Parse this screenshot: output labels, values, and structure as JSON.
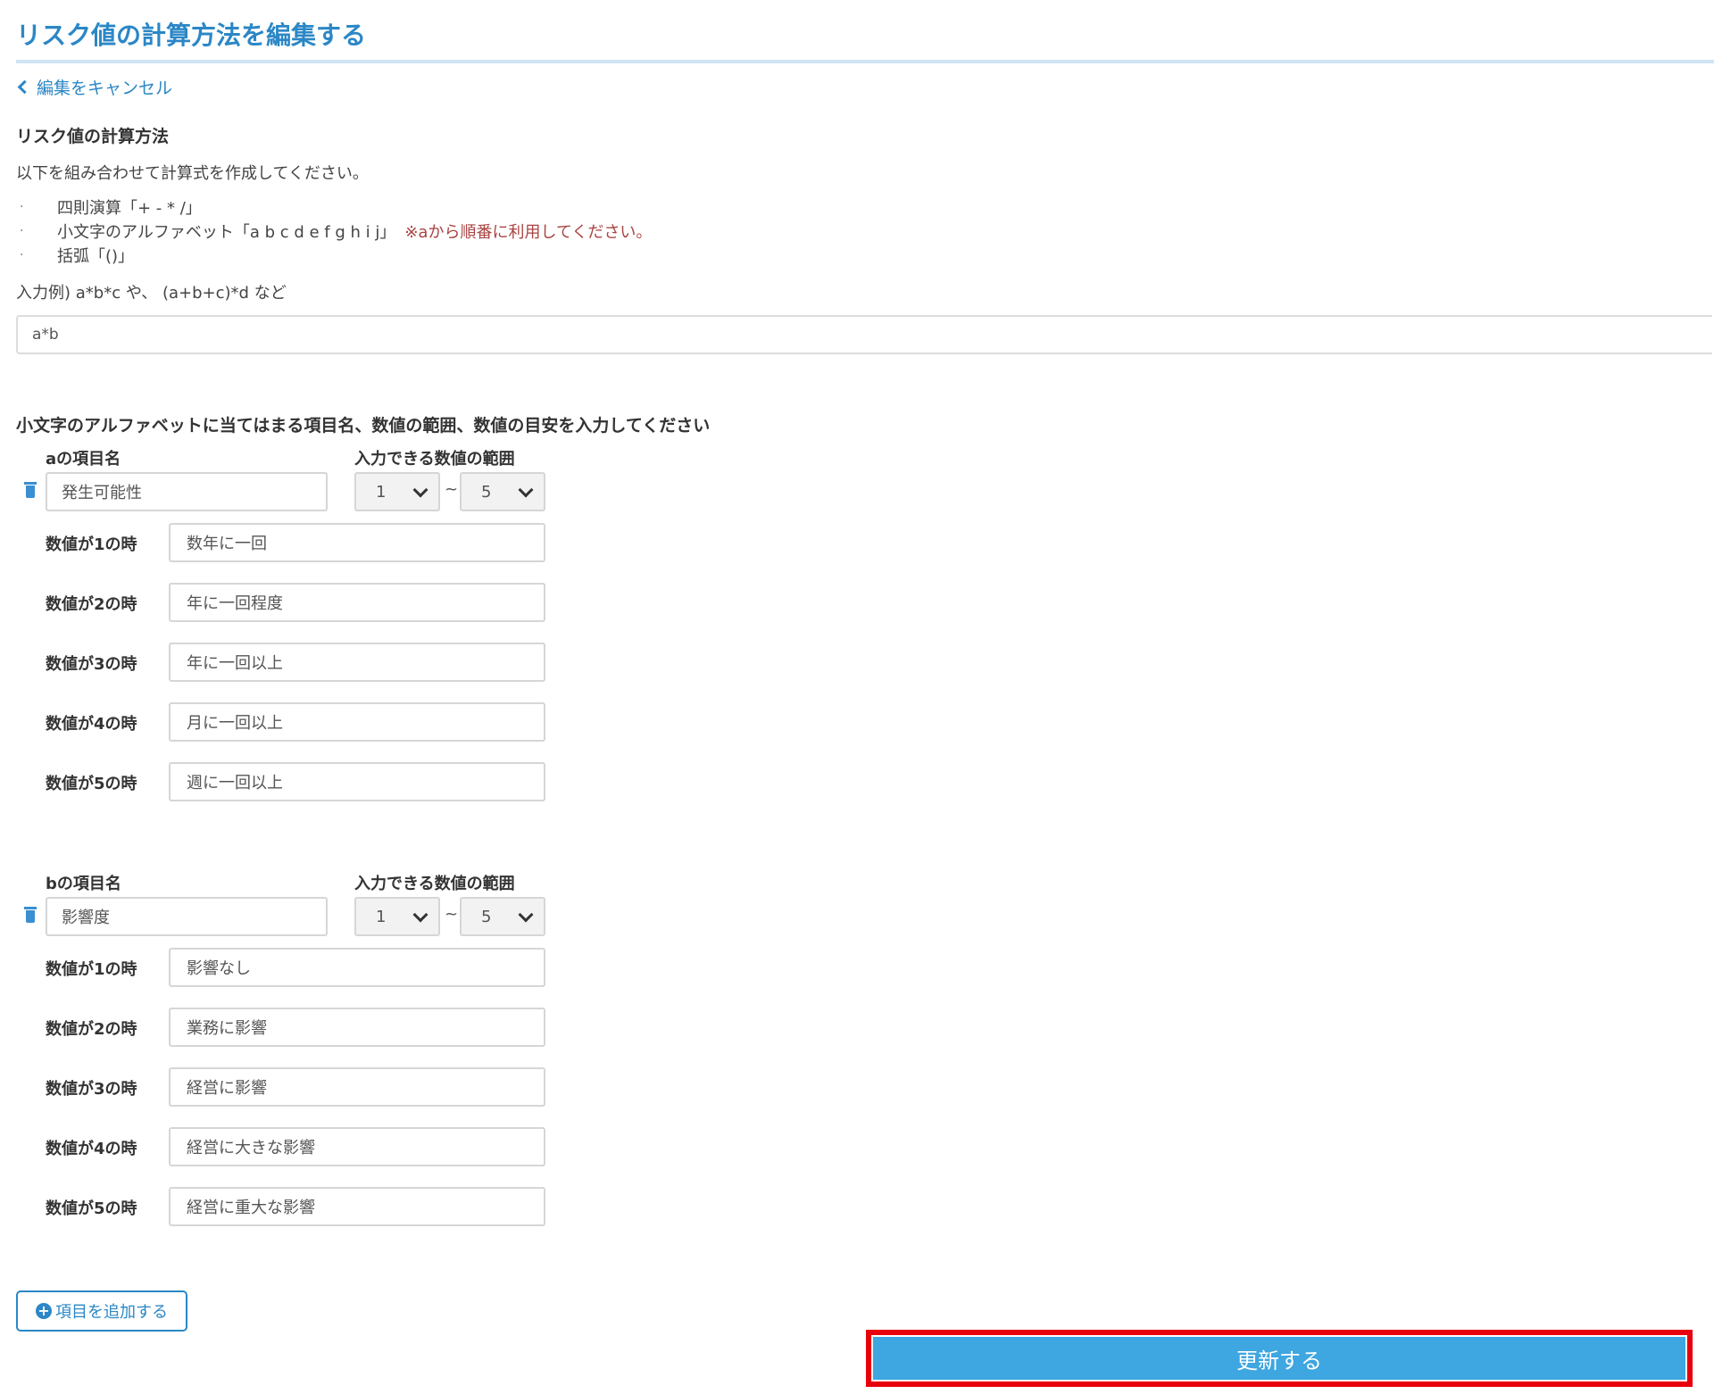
{
  "page": {
    "title": "リスク値の計算方法を編集する",
    "cancel_link": "編集をキャンセル"
  },
  "formula_section": {
    "heading": "リスク値の計算方法",
    "intro": "以下を組み合わせて計算式を作成してください。",
    "bullets": [
      {
        "text": "四則演算「+ - * /」",
        "note": ""
      },
      {
        "text": "小文字のアルファベット「a b c d e f g h i j」",
        "note": "※aから順番に利用してください。"
      },
      {
        "text": "括弧「()」",
        "note": ""
      }
    ],
    "example": "入力例) a*b*c や、 (a+b+c)*d など",
    "formula_value": "a*b"
  },
  "variables_section": {
    "heading": "小文字のアルファベットに当てはまる項目名、数値の範囲、数値の目安を入力してください",
    "range_label": "入力できる数値の範囲",
    "tilde": "~",
    "variables": [
      {
        "name_label": "aの項目名",
        "name_value": "発生可能性",
        "range_min": "1",
        "range_max": "5",
        "rows": [
          {
            "label": "数値が1の時",
            "value": "数年に一回"
          },
          {
            "label": "数値が2の時",
            "value": "年に一回程度"
          },
          {
            "label": "数値が3の時",
            "value": "年に一回以上"
          },
          {
            "label": "数値が4の時",
            "value": "月に一回以上"
          },
          {
            "label": "数値が5の時",
            "value": "週に一回以上"
          }
        ]
      },
      {
        "name_label": "bの項目名",
        "name_value": "影響度",
        "range_min": "1",
        "range_max": "5",
        "rows": [
          {
            "label": "数値が1の時",
            "value": "影響なし"
          },
          {
            "label": "数値が2の時",
            "value": "業務に影響"
          },
          {
            "label": "数値が3の時",
            "value": "経営に影響"
          },
          {
            "label": "数値が4の時",
            "value": "経営に大きな影響"
          },
          {
            "label": "数値が5の時",
            "value": "経営に重大な影響"
          }
        ]
      }
    ]
  },
  "actions": {
    "add_item_label": "項目を追加する",
    "update_label": "更新する"
  },
  "colors": {
    "accent": "#2b87c6",
    "update_button": "#3ea6e0",
    "highlight": "#e8000c",
    "note_red": "#a94442"
  }
}
